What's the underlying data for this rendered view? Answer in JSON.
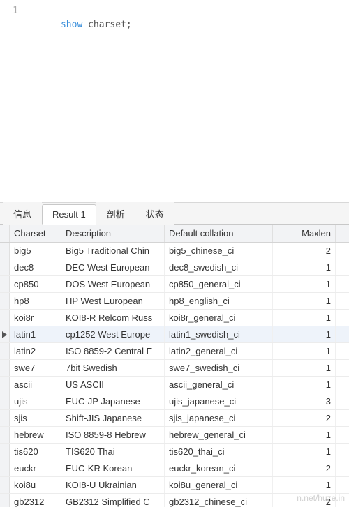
{
  "editor": {
    "line_number": "1",
    "keyword": "show",
    "rest": " charset;"
  },
  "tabs": [
    {
      "label": "信息",
      "active": false
    },
    {
      "label": "Result 1",
      "active": true
    },
    {
      "label": "剖析",
      "active": false
    },
    {
      "label": "状态",
      "active": false
    }
  ],
  "columns": {
    "charset": "Charset",
    "description": "Description",
    "collation": "Default collation",
    "maxlen": "Maxlen"
  },
  "rows": [
    {
      "charset": "big5",
      "description": "Big5 Traditional Chin",
      "collation": "big5_chinese_ci",
      "maxlen": "2",
      "current": false
    },
    {
      "charset": "dec8",
      "description": "DEC West European",
      "collation": "dec8_swedish_ci",
      "maxlen": "1",
      "current": false
    },
    {
      "charset": "cp850",
      "description": "DOS West European",
      "collation": "cp850_general_ci",
      "maxlen": "1",
      "current": false
    },
    {
      "charset": "hp8",
      "description": "HP West European",
      "collation": "hp8_english_ci",
      "maxlen": "1",
      "current": false
    },
    {
      "charset": "koi8r",
      "description": "KOI8-R Relcom Russ",
      "collation": "koi8r_general_ci",
      "maxlen": "1",
      "current": false
    },
    {
      "charset": "latin1",
      "description": "cp1252 West Europe",
      "collation": "latin1_swedish_ci",
      "maxlen": "1",
      "current": true
    },
    {
      "charset": "latin2",
      "description": "ISO 8859-2 Central E",
      "collation": "latin2_general_ci",
      "maxlen": "1",
      "current": false
    },
    {
      "charset": "swe7",
      "description": "7bit Swedish",
      "collation": "swe7_swedish_ci",
      "maxlen": "1",
      "current": false
    },
    {
      "charset": "ascii",
      "description": "US ASCII",
      "collation": "ascii_general_ci",
      "maxlen": "1",
      "current": false
    },
    {
      "charset": "ujis",
      "description": "EUC-JP Japanese",
      "collation": "ujis_japanese_ci",
      "maxlen": "3",
      "current": false
    },
    {
      "charset": "sjis",
      "description": "Shift-JIS Japanese",
      "collation": "sjis_japanese_ci",
      "maxlen": "2",
      "current": false
    },
    {
      "charset": "hebrew",
      "description": "ISO 8859-8 Hebrew",
      "collation": "hebrew_general_ci",
      "maxlen": "1",
      "current": false
    },
    {
      "charset": "tis620",
      "description": "TIS620 Thai",
      "collation": "tis620_thai_ci",
      "maxlen": "1",
      "current": false
    },
    {
      "charset": "euckr",
      "description": "EUC-KR Korean",
      "collation": "euckr_korean_ci",
      "maxlen": "2",
      "current": false
    },
    {
      "charset": "koi8u",
      "description": "KOI8-U Ukrainian",
      "collation": "koi8u_general_ci",
      "maxlen": "1",
      "current": false
    },
    {
      "charset": "gb2312",
      "description": "GB2312 Simplified C",
      "collation": "gb2312_chinese_ci",
      "maxlen": "2",
      "current": false
    }
  ],
  "watermark": "n.net/huze.in"
}
